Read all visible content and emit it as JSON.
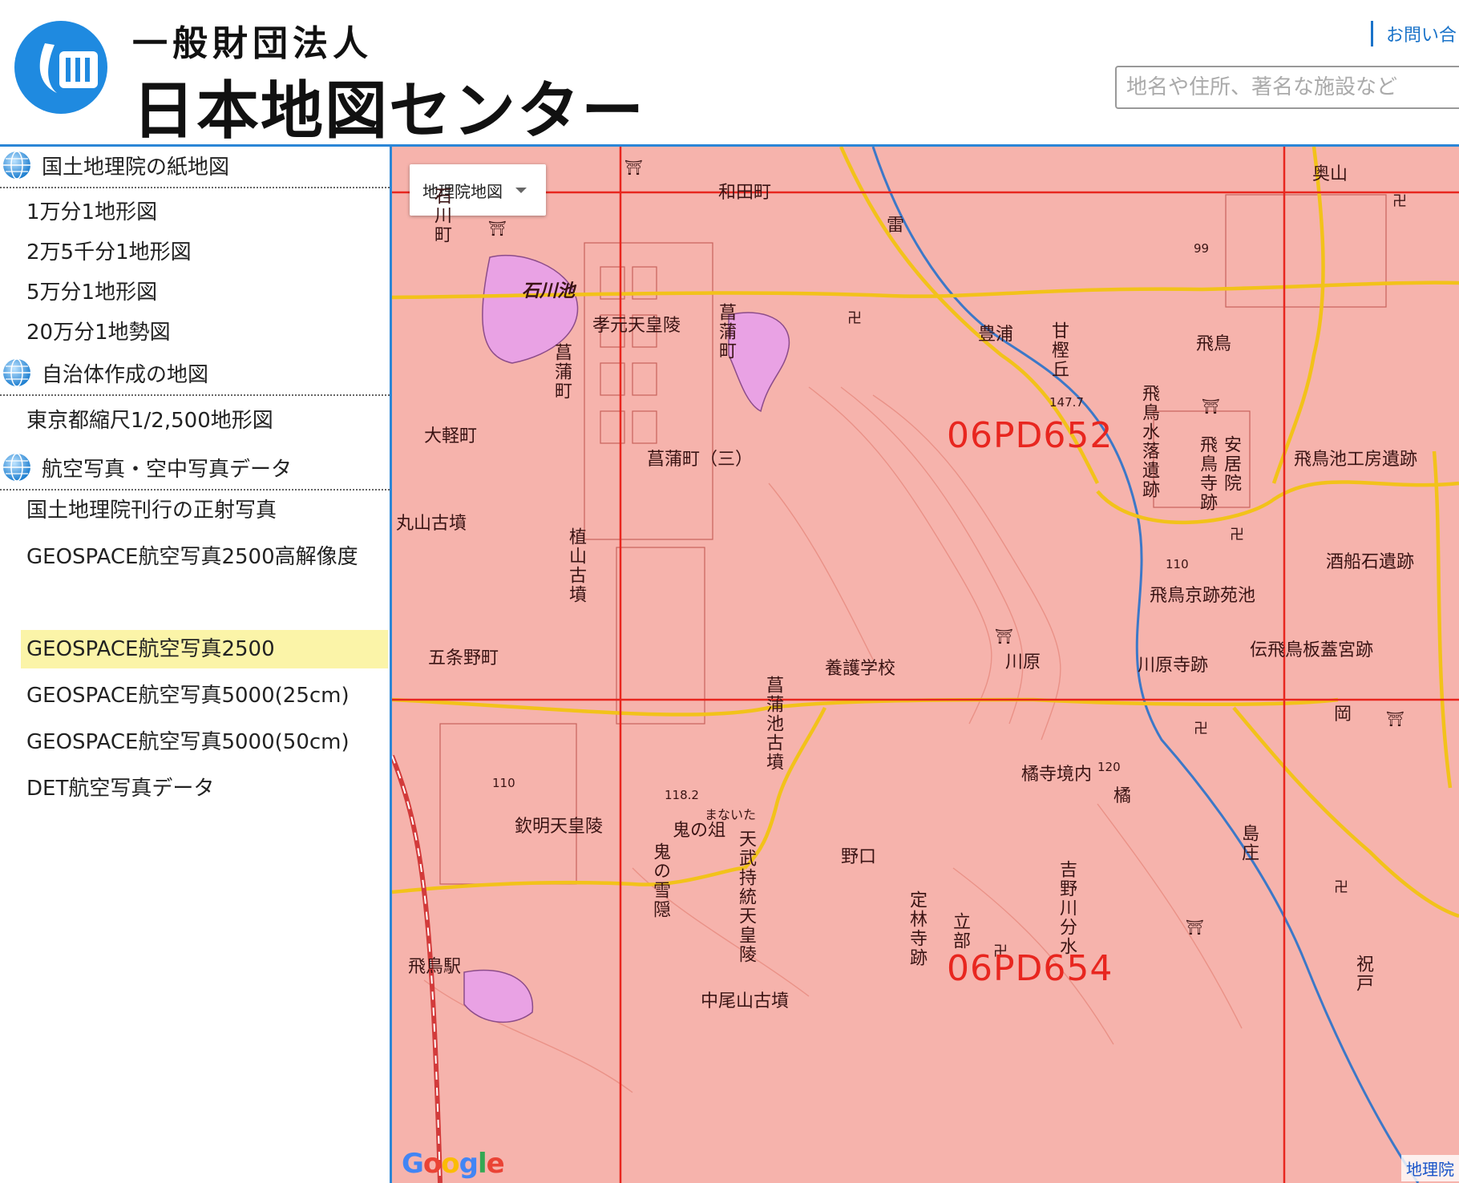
{
  "header": {
    "org_sub": "一般財団法人",
    "org_main": "日本地図センター",
    "contact_link": "お問い合",
    "search_placeholder": "地名や住所、著名な施設など"
  },
  "sidebar": {
    "categories": [
      {
        "label": "国土地理院の紙地図",
        "items": [
          "1万分1地形図",
          "2万5千分1地形図",
          "5万分1地形図",
          "20万分1地勢図"
        ]
      },
      {
        "label": "自治体作成の地図",
        "items": [
          "東京都縮尺1/2,500地形図"
        ]
      },
      {
        "label": "航空写真・空中写真データ",
        "items": [
          "国土地理院刊行の正射写真",
          "GEOSPACE航空写真2500高解像度",
          "GEOSPACE航空写真2500",
          "GEOSPACE航空写真5000(25cm)",
          "GEOSPACE航空写真5000(50cm)",
          "DET航空写真データ"
        ]
      }
    ],
    "active_item": "GEOSPACE航空写真2500"
  },
  "map": {
    "map_type": "地理院地図",
    "grid_labels": [
      "06PD652",
      "06PD654"
    ],
    "places": {
      "wadacho": "和田町",
      "ishikawacho": "石川町",
      "ishikawaike": "石川池",
      "kogen": "孝元天皇陵",
      "shobucho_v": "菖蒲町",
      "ikazuchi": "雷",
      "toyura": "豊浦",
      "amakashi": "甘樫丘",
      "asuka": "飛鳥",
      "okuyama": "奥山",
      "oharucho": "大軽町",
      "shobucho3": "菖蒲町（三）",
      "asuka_suirakuiseki": "飛鳥水落遺跡",
      "asukadera": "飛鳥寺跡",
      "ango": "安居院",
      "ikekobo": "飛鳥池工房遺跡",
      "maruyama": "丸山古墳",
      "ueyama": "植山古墳",
      "sakafuneishi": "酒船石遺跡",
      "kyoato": "飛鳥京跡苑池",
      "gojonocho": "五条野町",
      "yogogakko": "養護学校",
      "kawahara": "川原",
      "kawaharadera": "川原寺跡",
      "itabuki": "伝飛鳥板蓋宮跡",
      "shobuike": "菖蒲池古墳",
      "tachibana": "橘寺境内",
      "oka": "岡",
      "kinmei": "欽明天皇陵",
      "onimanaita": "鬼の俎",
      "onisecchin": "鬼の雪隠",
      "tenmu": "天武持統天皇陵",
      "noguchi": "野口",
      "jorinji": "定林寺跡",
      "tatebe": "立部",
      "yoshino": "吉野川分水",
      "shimasho": "島庄",
      "asukaeki": "飛鳥駅",
      "nakaoyama": "中尾山古墳",
      "iwaido": "祝戸",
      "tachibana_kanji": "橘",
      "manaita_kana": "まないた",
      "elev_147": "147.7",
      "elev_118": "118.2",
      "contour_110": "110",
      "contour_120": "120",
      "route_99": "99",
      "elev_110b": "110"
    },
    "google_logo": "Google",
    "attribution": "地理院"
  },
  "colors": {
    "accent_blue": "#2b86d6",
    "active_highlight": "#fbf4a8",
    "map_base": "#f6b3ac",
    "grid_red": "#e8261f",
    "road_yellow": "#f2c21a",
    "pond_pink": "#e9a2e4"
  }
}
